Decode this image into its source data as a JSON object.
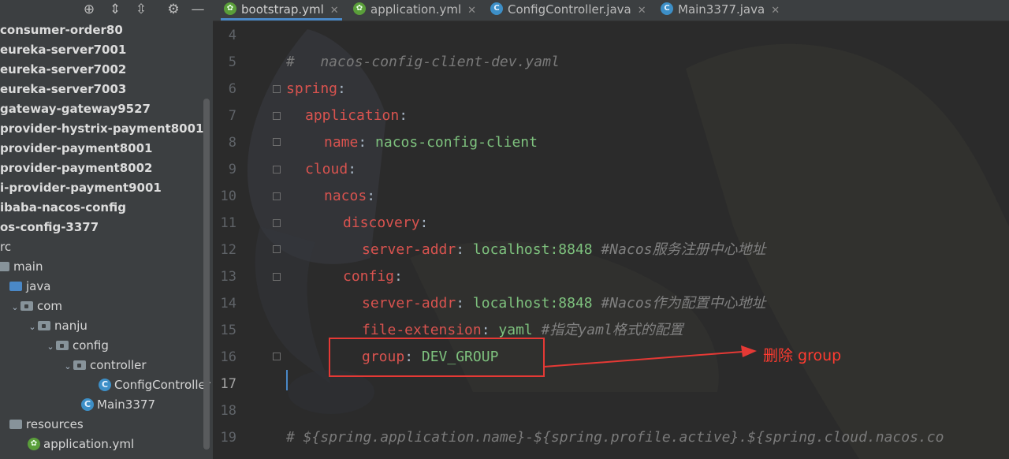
{
  "sidebar": {
    "toolbar_icons": [
      "crosshair-icon",
      "expand-all-icon",
      "collapse-all-icon",
      "gear-icon",
      "hide-icon"
    ],
    "items": [
      {
        "label": "consumer-order80",
        "bold": true
      },
      {
        "label": "eureka-server7001",
        "bold": true
      },
      {
        "label": "eureka-server7002",
        "bold": true
      },
      {
        "label": "eureka-server7003",
        "bold": true
      },
      {
        "label": "gateway-gateway9527",
        "bold": true
      },
      {
        "label": "provider-hystrix-payment8001",
        "bold": true
      },
      {
        "label": "provider-payment8001",
        "bold": true
      },
      {
        "label": "provider-payment8002",
        "bold": true
      },
      {
        "label": "i-provider-payment9001",
        "bold": true
      },
      {
        "label": "ibaba-nacos-config",
        "bold": true
      },
      {
        "label": "os-config-3377",
        "bold": true
      },
      {
        "label": "rc",
        "bold": false
      },
      {
        "label": "main",
        "bold": false
      },
      {
        "label": "java",
        "bold": false
      },
      {
        "label": "com",
        "bold": false
      },
      {
        "label": "nanju",
        "bold": false
      },
      {
        "label": "config",
        "bold": false
      },
      {
        "label": "controller",
        "bold": false
      },
      {
        "label": "ConfigController",
        "bold": false
      },
      {
        "label": "Main3377",
        "bold": false
      },
      {
        "label": "resources",
        "bold": false
      },
      {
        "label": "application.yml",
        "bold": false
      }
    ]
  },
  "tabs": [
    {
      "label": "bootstrap.yml",
      "icon": "spring-config-icon",
      "active": true
    },
    {
      "label": "application.yml",
      "icon": "spring-config-icon",
      "active": false
    },
    {
      "label": "ConfigController.java",
      "icon": "class-icon",
      "active": false
    },
    {
      "label": "Main3377.java",
      "icon": "spring-class-icon",
      "active": false
    }
  ],
  "editor": {
    "line_numbers": [
      "4",
      "5",
      "6",
      "7",
      "8",
      "9",
      "10",
      "11",
      "12",
      "13",
      "14",
      "15",
      "16",
      "17",
      "18",
      "19"
    ],
    "current_line": "17",
    "lines": {
      "l5": "#   nacos-config-client-dev.yaml",
      "l6_key": "spring",
      "l6_colon": ":",
      "l7_key": "application",
      "l7_colon": ":",
      "l8_key": "name",
      "l8_colon": ": ",
      "l8_val": "nacos-config-client",
      "l9_key": "cloud",
      "l9_colon": ":",
      "l10_key": "nacos",
      "l10_colon": ":",
      "l11_key": "discovery",
      "l11_colon": ":",
      "l12_key": "server-addr",
      "l12_colon": ": ",
      "l12_val": "localhost:8848 ",
      "l12_cmt": "#Nacos服务注册中心地址",
      "l13_key": "config",
      "l13_colon": ":",
      "l14_key": "server-addr",
      "l14_colon": ": ",
      "l14_val": "localhost:8848 ",
      "l14_cmt": "#Nacos作为配置中心地址",
      "l15_key": "file-extension",
      "l15_colon": ": ",
      "l15_val": "yaml ",
      "l15_cmt": "#指定yaml格式的配置",
      "l16_key": "group",
      "l16_colon": ": ",
      "l16_val": "DEV_GROUP",
      "l19": "# ${spring.application.name}-${spring.profile.active}.${spring.cloud.nacos.co"
    }
  },
  "annotation": {
    "text": "删除 group",
    "color": "#e53935"
  },
  "colors": {
    "sidebar_bg": "#3c3f41",
    "editor_bg": "#2b2b2b",
    "active_tab_underline": "#4a88c7",
    "yaml_key": "#e06c75",
    "yaml_value": "#7ec27e",
    "comment": "#808080"
  }
}
